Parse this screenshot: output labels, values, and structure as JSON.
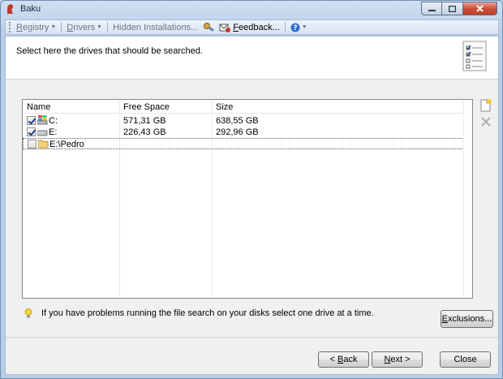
{
  "window": {
    "title": "Baku"
  },
  "menubar": {
    "items": [
      {
        "label_u": "R",
        "label_rest": "egistry",
        "has_arrow": true
      },
      {
        "label_u": "D",
        "label_rest": "rivers",
        "has_arrow": true
      },
      {
        "label": "Hidden Installations..."
      },
      {
        "label_u": "F",
        "label_rest": "eedback..."
      }
    ]
  },
  "header": {
    "text": "Select here the drives that should be searched."
  },
  "list": {
    "columns": [
      "Name",
      "Free Space",
      "Size"
    ],
    "rows": [
      {
        "checked": true,
        "icon": "system-drive-icon",
        "name": "C:",
        "free": "571,31 GB",
        "size": "638,55 GB"
      },
      {
        "checked": true,
        "icon": "drive-icon",
        "name": "E:",
        "free": "226,43 GB",
        "size": "292,96 GB"
      },
      {
        "checked": false,
        "icon": "folder-icon",
        "name": "E:\\Pedro",
        "free": "",
        "size": ""
      }
    ]
  },
  "tip": {
    "text": "If you have problems running the file search on your disks select one drive at a time."
  },
  "buttons": {
    "exclusions_u": "E",
    "exclusions_rest": "xclusions...",
    "back_pre": "< ",
    "back_u": "B",
    "back_rest": "ack",
    "next_u": "N",
    "next_rest": "ext >",
    "close": "Close"
  },
  "colors": {
    "accent": "#1c3f8a",
    "frame": "#b9cfe8",
    "close_button": "#c7503a"
  }
}
